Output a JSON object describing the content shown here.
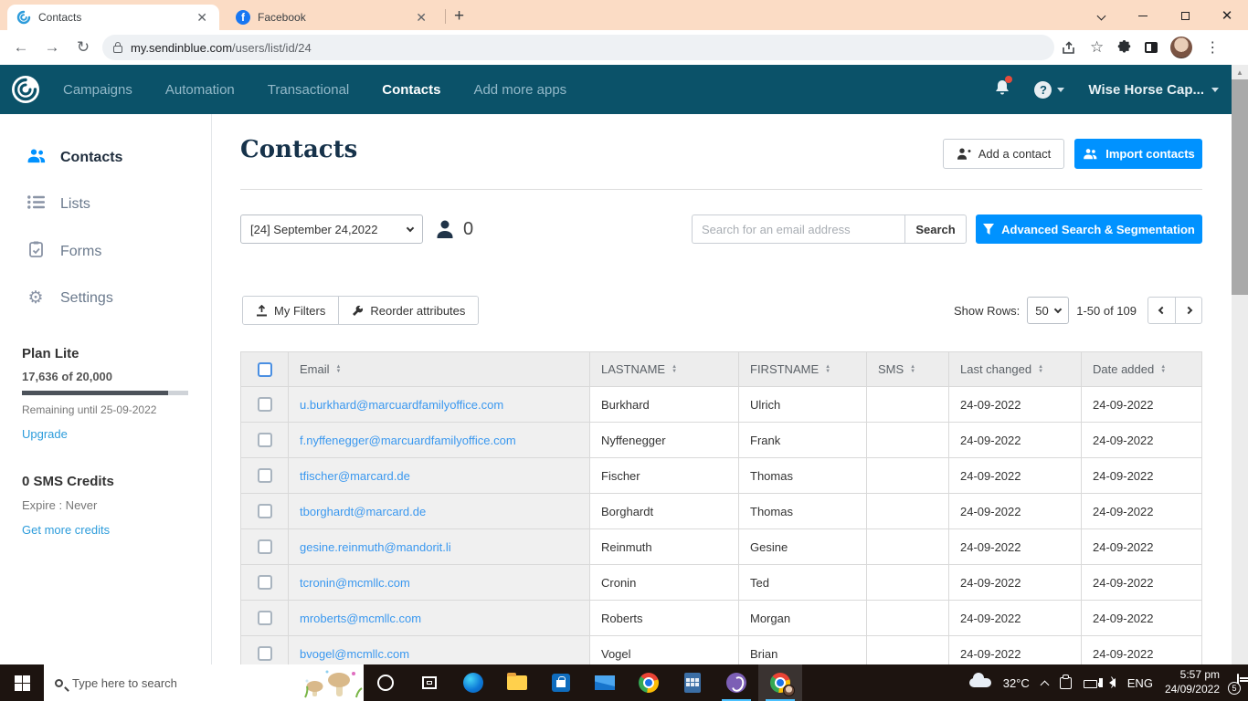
{
  "browser": {
    "tab1": {
      "title": "Contacts"
    },
    "tab2": {
      "title": "Facebook"
    },
    "url_domain": "my.sendinblue.com",
    "url_path": "/users/list/id/24"
  },
  "topnav": {
    "items": [
      "Campaigns",
      "Automation",
      "Transactional",
      "Contacts",
      "Add more apps"
    ],
    "account": "Wise Horse Cap..."
  },
  "sidebar": {
    "items": [
      {
        "label": "Contacts"
      },
      {
        "label": "Lists"
      },
      {
        "label": "Forms"
      },
      {
        "label": "Settings"
      }
    ],
    "plan": {
      "title": "Plan Lite",
      "usage": "17,636 of 20,000",
      "progress_pct": 88,
      "remaining": "Remaining until 25-09-2022",
      "upgrade_label": "Upgrade"
    },
    "sms": {
      "title": "0 SMS Credits",
      "expire": "Expire : Never",
      "link_label": "Get more credits"
    }
  },
  "main": {
    "title": "Contacts",
    "add_contact_label": "Add a contact",
    "import_contacts_label": "Import contacts",
    "list_selector_value": "[24] September 24,2022",
    "selected_count": "0",
    "search_placeholder": "Search for an email address",
    "search_button_label": "Search",
    "advanced_search_label": "Advanced Search & Segmentation",
    "my_filters_label": "My Filters",
    "reorder_label": "Reorder attributes",
    "show_rows_label": "Show Rows:",
    "rows_per_page": "50",
    "range_label": "1-50 of 109"
  },
  "table": {
    "columns": [
      "Email",
      "LASTNAME",
      "FIRSTNAME",
      "SMS",
      "Last changed",
      "Date added"
    ],
    "rows": [
      {
        "email": "u.burkhard@marcuardfamilyoffice.com",
        "lastname": "Burkhard",
        "firstname": "Ulrich",
        "sms": "",
        "last_changed": "24-09-2022",
        "date_added": "24-09-2022"
      },
      {
        "email": "f.nyffenegger@marcuardfamilyoffice.com",
        "lastname": "Nyffenegger",
        "firstname": "Frank",
        "sms": "",
        "last_changed": "24-09-2022",
        "date_added": "24-09-2022"
      },
      {
        "email": "tfischer@marcard.de",
        "lastname": "Fischer",
        "firstname": "Thomas",
        "sms": "",
        "last_changed": "24-09-2022",
        "date_added": "24-09-2022"
      },
      {
        "email": "tborghardt@marcard.de",
        "lastname": "Borghardt",
        "firstname": "Thomas",
        "sms": "",
        "last_changed": "24-09-2022",
        "date_added": "24-09-2022"
      },
      {
        "email": "gesine.reinmuth@mandorit.li",
        "lastname": "Reinmuth",
        "firstname": "Gesine",
        "sms": "",
        "last_changed": "24-09-2022",
        "date_added": "24-09-2022"
      },
      {
        "email": "tcronin@mcmllc.com",
        "lastname": "Cronin",
        "firstname": "Ted",
        "sms": "",
        "last_changed": "24-09-2022",
        "date_added": "24-09-2022"
      },
      {
        "email": "mroberts@mcmllc.com",
        "lastname": "Roberts",
        "firstname": "Morgan",
        "sms": "",
        "last_changed": "24-09-2022",
        "date_added": "24-09-2022"
      },
      {
        "email": "bvogel@mcmllc.com",
        "lastname": "Vogel",
        "firstname": "Brian",
        "sms": "",
        "last_changed": "24-09-2022",
        "date_added": "24-09-2022"
      }
    ]
  },
  "taskbar": {
    "search_placeholder": "Type here to search",
    "temperature": "32°C",
    "language": "ENG",
    "time": "5:57 pm",
    "date": "24/09/2022",
    "notification_count": "5"
  },
  "colors": {
    "accent_blue": "#0092ff",
    "nav_bg": "#0b5269",
    "link_blue": "#3a98ef",
    "tabstrip_peach": "#fbdcc5",
    "title_navy": "#16324a",
    "taskbar_bg": "#1d1410"
  }
}
